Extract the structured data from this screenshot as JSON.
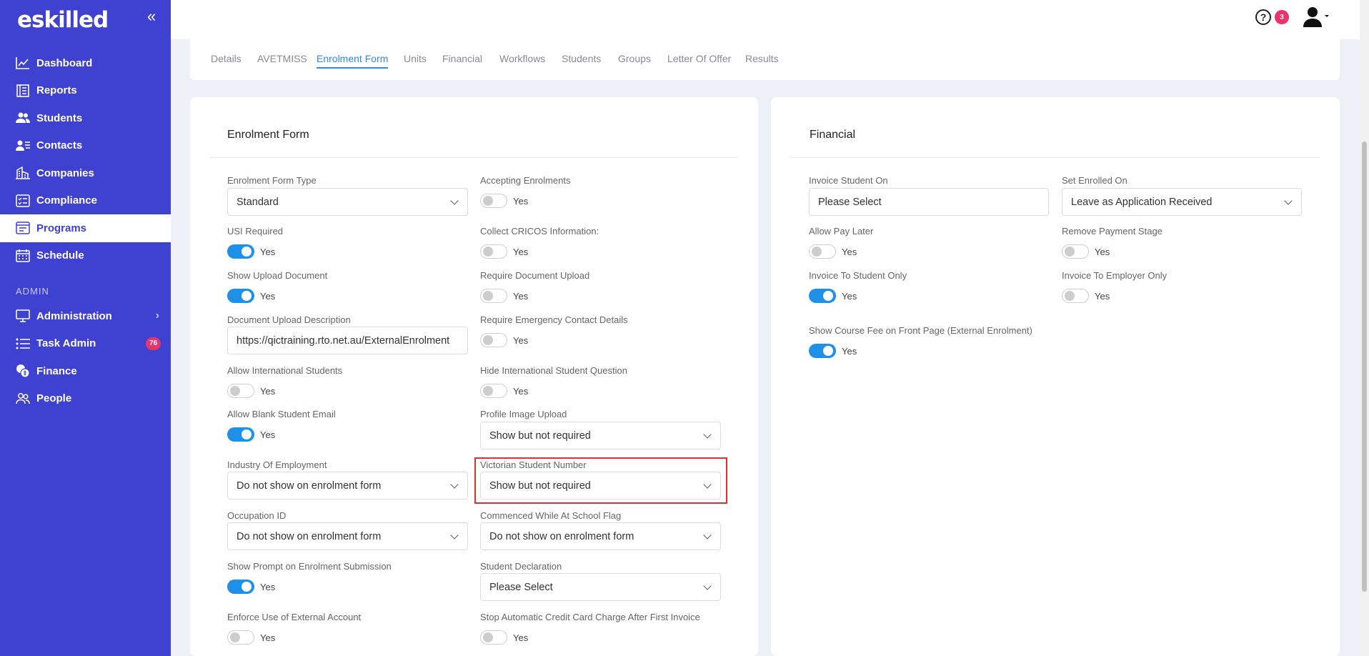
{
  "brand": {
    "logo": "eskilled"
  },
  "sidebar": {
    "items": [
      {
        "label": "Dashboard",
        "icon": "chart-line-icon"
      },
      {
        "label": "Reports",
        "icon": "report-icon"
      },
      {
        "label": "Students",
        "icon": "users-icon"
      },
      {
        "label": "Contacts",
        "icon": "contacts-icon"
      },
      {
        "label": "Companies",
        "icon": "building-icon"
      },
      {
        "label": "Compliance",
        "icon": "checklist-icon"
      },
      {
        "label": "Programs",
        "icon": "programs-icon",
        "active": true
      },
      {
        "label": "Schedule",
        "icon": "calendar-icon"
      }
    ],
    "section_admin": "ADMIN",
    "admin_items": [
      {
        "label": "Administration",
        "icon": "monitor-icon"
      },
      {
        "label": "Task Admin",
        "icon": "list-icon",
        "badge": "76"
      },
      {
        "label": "Finance",
        "icon": "coins-icon"
      },
      {
        "label": "People",
        "icon": "people-icon"
      }
    ]
  },
  "topbar": {
    "help_symbol": "?",
    "notification_count": "3"
  },
  "tabs": [
    "Details",
    "AVETMISS",
    "Enrolment Form",
    "Units",
    "Financial",
    "Workflows",
    "Students",
    "Groups",
    "Letter Of Offer",
    "Results"
  ],
  "active_tab": "Enrolment Form",
  "enrolment_form": {
    "title": "Enrolment Form",
    "fields": {
      "enrolment_form_type": {
        "label": "Enrolment Form Type",
        "value": "Standard"
      },
      "accepting_enrolments": {
        "label": "Accepting Enrolments",
        "toggle": "Yes",
        "on": false
      },
      "usi_required": {
        "label": "USI Required",
        "toggle": "Yes",
        "on": true
      },
      "collect_cricos": {
        "label": "Collect CRICOS Information:",
        "toggle": "Yes",
        "on": false
      },
      "show_upload_document": {
        "label": "Show Upload Document",
        "toggle": "Yes",
        "on": true
      },
      "require_document_upload": {
        "label": "Require Document Upload",
        "toggle": "Yes",
        "on": false
      },
      "document_upload_description": {
        "label": "Document Upload Description",
        "value": "https://qictraining.rto.net.au/ExternalEnrolment"
      },
      "require_emergency_contact": {
        "label": "Require Emergency Contact Details",
        "toggle": "Yes",
        "on": false
      },
      "allow_international_students": {
        "label": "Allow International Students",
        "toggle": "Yes",
        "on": false
      },
      "hide_international_question": {
        "label": "Hide International Student Question",
        "toggle": "Yes",
        "on": false
      },
      "allow_blank_email": {
        "label": "Allow Blank Student Email",
        "toggle": "Yes",
        "on": true
      },
      "profile_image_upload": {
        "label": "Profile Image Upload",
        "value": "Show but not required"
      },
      "industry_of_employment": {
        "label": "Industry Of Employment",
        "value": "Do not show on enrolment form"
      },
      "victorian_student_number": {
        "label": "Victorian Student Number",
        "value": "Show but not required"
      },
      "occupation_id": {
        "label": "Occupation ID",
        "value": "Do not show on enrolment form"
      },
      "commenced_at_school": {
        "label": "Commenced While At School Flag",
        "value": "Do not show on enrolment form"
      },
      "show_prompt_submission": {
        "label": "Show Prompt on Enrolment Submission",
        "toggle": "Yes",
        "on": true
      },
      "student_declaration": {
        "label": "Student Declaration",
        "value": "Please Select"
      },
      "enforce_external_account": {
        "label": "Enforce Use of External Account",
        "toggle": "Yes",
        "on": false
      },
      "stop_auto_cc_charge": {
        "label": "Stop Automatic Credit Card Charge After First Invoice",
        "toggle": "Yes",
        "on": false
      }
    }
  },
  "financial": {
    "title": "Financial",
    "fields": {
      "invoice_student_on": {
        "label": "Invoice Student On",
        "value": "Please Select"
      },
      "set_enrolled_on": {
        "label": "Set Enrolled On",
        "value": "Leave as Application Received"
      },
      "allow_pay_later": {
        "label": "Allow Pay Later",
        "toggle": "Yes",
        "on": false
      },
      "remove_payment_stage": {
        "label": "Remove Payment Stage",
        "toggle": "Yes",
        "on": false
      },
      "invoice_to_student_only": {
        "label": "Invoice To Student Only",
        "toggle": "Yes",
        "on": true
      },
      "invoice_to_employer_only": {
        "label": "Invoice To Employer Only",
        "toggle": "Yes",
        "on": false
      },
      "show_course_fee": {
        "label": "Show Course Fee on Front Page (External Enrolment)",
        "toggle": "Yes",
        "on": true
      }
    }
  },
  "colors": {
    "sidebar": "#3f41d1",
    "accent": "#1e90e8",
    "badge": "#e8336b",
    "highlight": "#e0302e"
  }
}
